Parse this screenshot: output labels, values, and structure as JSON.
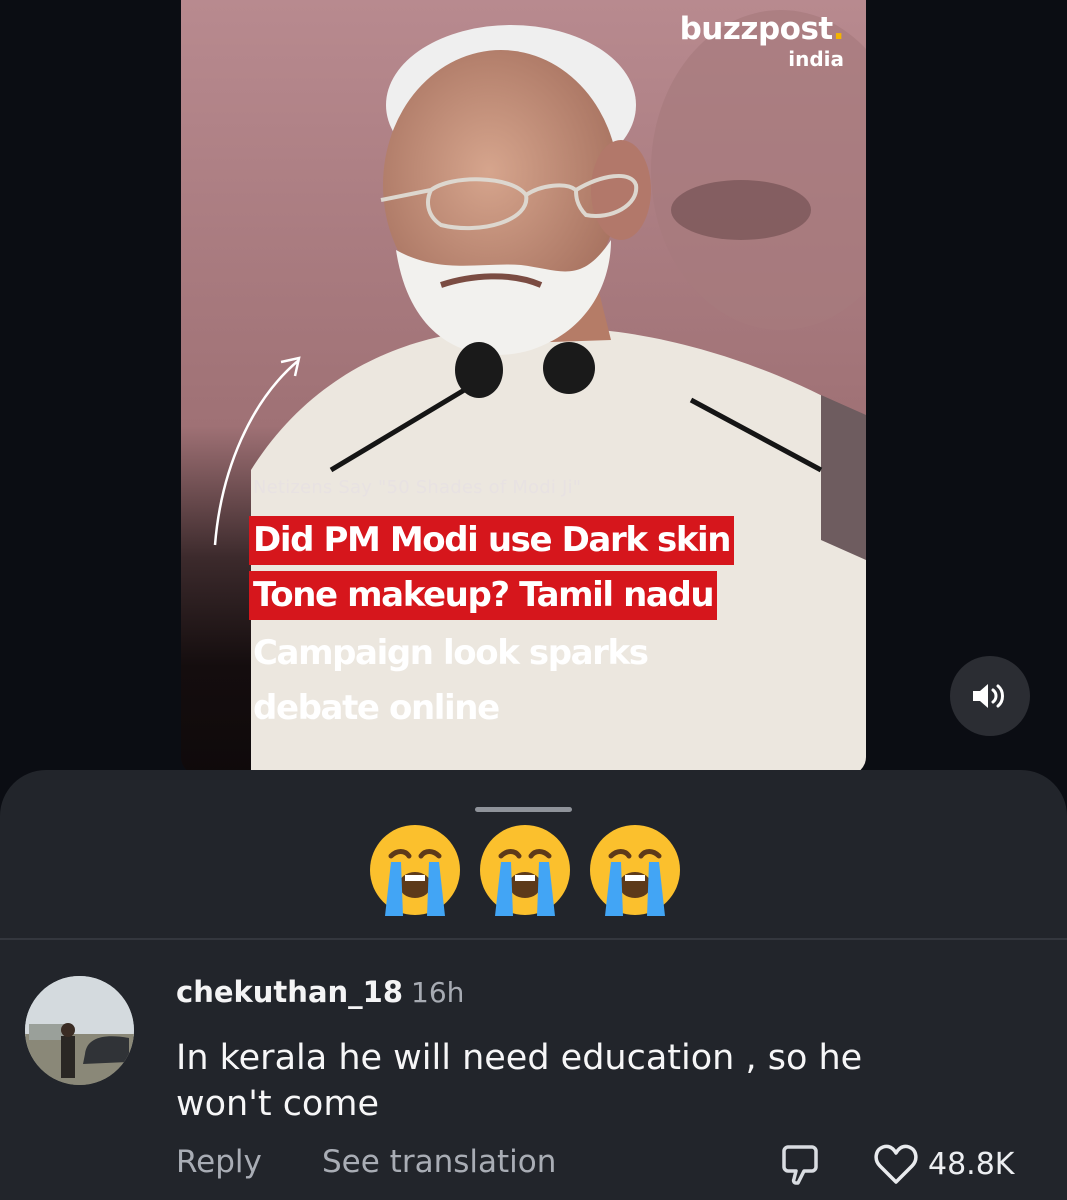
{
  "post": {
    "brand_name": "buzzpost",
    "brand_dot": ".",
    "brand_sub": "india",
    "kicker": "Netizens Say \"50 Shades of Modi Ji\"",
    "headline_lines": [
      "Did PM Modi use Dark skin",
      "Tone makeup? Tamil nadu",
      "Campaign look sparks",
      "debate online"
    ],
    "headline_highlight_color": "#d6161c"
  },
  "volume": {
    "icon": "speaker-icon"
  },
  "sheet": {
    "background": "#22252b",
    "reactions": [
      "😭",
      "😭",
      "😭"
    ],
    "comment": {
      "username": "chekuthan_18",
      "time": "16h",
      "text_lines": [
        "In kerala he will need education , so he",
        "won't come"
      ],
      "reply_label": "Reply",
      "see_translation_label": "See translation",
      "like_count": "48.8K"
    }
  }
}
